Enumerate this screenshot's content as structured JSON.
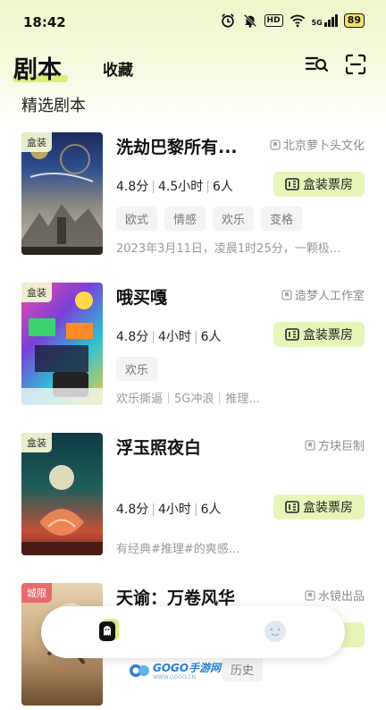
{
  "status_bar": {
    "time": "18:42",
    "hd_label": "HD",
    "signal_label": "5G",
    "battery": "89",
    "icons": [
      "alarm-icon",
      "mute-bell-icon",
      "hd-icon",
      "wifi-icon",
      "signal-icon",
      "battery-icon"
    ]
  },
  "top_nav": {
    "active_tab": "剧本",
    "inactive_tab": "收藏",
    "icons": [
      "filter-search-icon",
      "scan-icon"
    ]
  },
  "section_title": "精选剧本",
  "cards": [
    {
      "badge": "盒装",
      "title": "洗劫巴黎所有...",
      "publisher": "北京萝卜头文化",
      "rating": "4.8分",
      "duration": "4.5小时",
      "players": "6人",
      "cta": "盒装票房",
      "tags": [
        "欧式",
        "情感",
        "欢乐",
        "变格"
      ],
      "desc": "2023年3月11日，凌晨1时25分，一颗极..."
    },
    {
      "badge": "盒装",
      "title": "哦买嘎",
      "publisher": "造梦人工作室",
      "rating": "4.8分",
      "duration": "4小时",
      "players": "6人",
      "cta": "盒装票房",
      "tags": [
        "欢乐"
      ],
      "desc": "欢乐撕逼｜5G冲浪｜推理..."
    },
    {
      "badge": "盒装",
      "title": "浮玉照夜白",
      "publisher": "方块巨制",
      "rating": "4.8分",
      "duration": "4小时",
      "players": "6人",
      "cta": "盒装票房",
      "tags": [],
      "desc": "有经典#推理#的爽感..."
    },
    {
      "badge": "城限",
      "title": "天谕：万卷风华",
      "publisher": "水镜出品",
      "cta_partial": "房",
      "tags": [
        "历史"
      ]
    }
  ],
  "watermark": {
    "text": "GOGO手游网",
    "sub": "WWW.GOGO.CN"
  },
  "colors": {
    "accent": "#d8f07a",
    "cta_bg": "#e7f5b9",
    "badge_red": "#e86a6a"
  }
}
